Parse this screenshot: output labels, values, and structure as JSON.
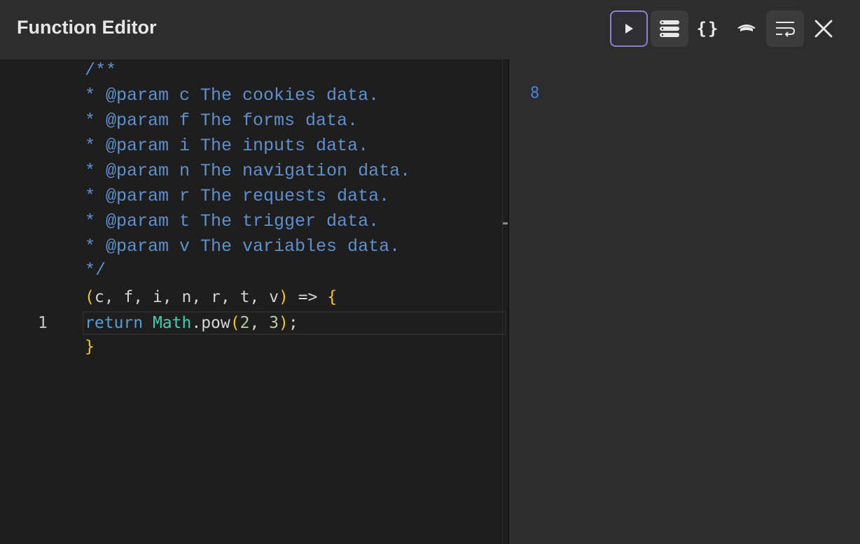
{
  "header": {
    "title": "Function Editor"
  },
  "toolbar": {
    "buttons": [
      {
        "name": "run",
        "icon": "play-icon"
      },
      {
        "name": "list",
        "icon": "list-icon"
      },
      {
        "name": "json",
        "icon": "braces-icon",
        "glyph": "{}"
      },
      {
        "name": "hat",
        "icon": "graduation-cap-icon"
      },
      {
        "name": "wrap",
        "icon": "word-wrap-icon"
      },
      {
        "name": "close",
        "icon": "close-icon"
      }
    ]
  },
  "editor": {
    "comment_lines": [
      "/**",
      "* @param c The cookies data.",
      "* @param f The forms data.",
      "* @param i The inputs data.",
      "* @param n The navigation data.",
      "* @param r The requests data.",
      "* @param t The trigger data.",
      "* @param v The variables data.",
      "*/"
    ],
    "signature": {
      "open_paren": "(",
      "params": "c, f, i, n, r, t, v",
      "close_paren": ")",
      "arrow": " => ",
      "open_brace": "{"
    },
    "body": {
      "line_number": "1",
      "keyword": "return",
      "object": "Math",
      "dot": ".",
      "method": "pow",
      "open_paren": "(",
      "arg1": "2",
      "comma": ", ",
      "arg2": "3",
      "close_paren": ")",
      "semicolon": ";"
    },
    "closing_brace": "}"
  },
  "output": {
    "value": "8"
  },
  "colors": {
    "accent": "#8d7fd4",
    "comment": "#5f8fcf",
    "keyword": "#569cd6",
    "class": "#4ec9b0",
    "brace": "#f0c534",
    "number": "#b5cea8",
    "output": "#4a7fe0"
  }
}
